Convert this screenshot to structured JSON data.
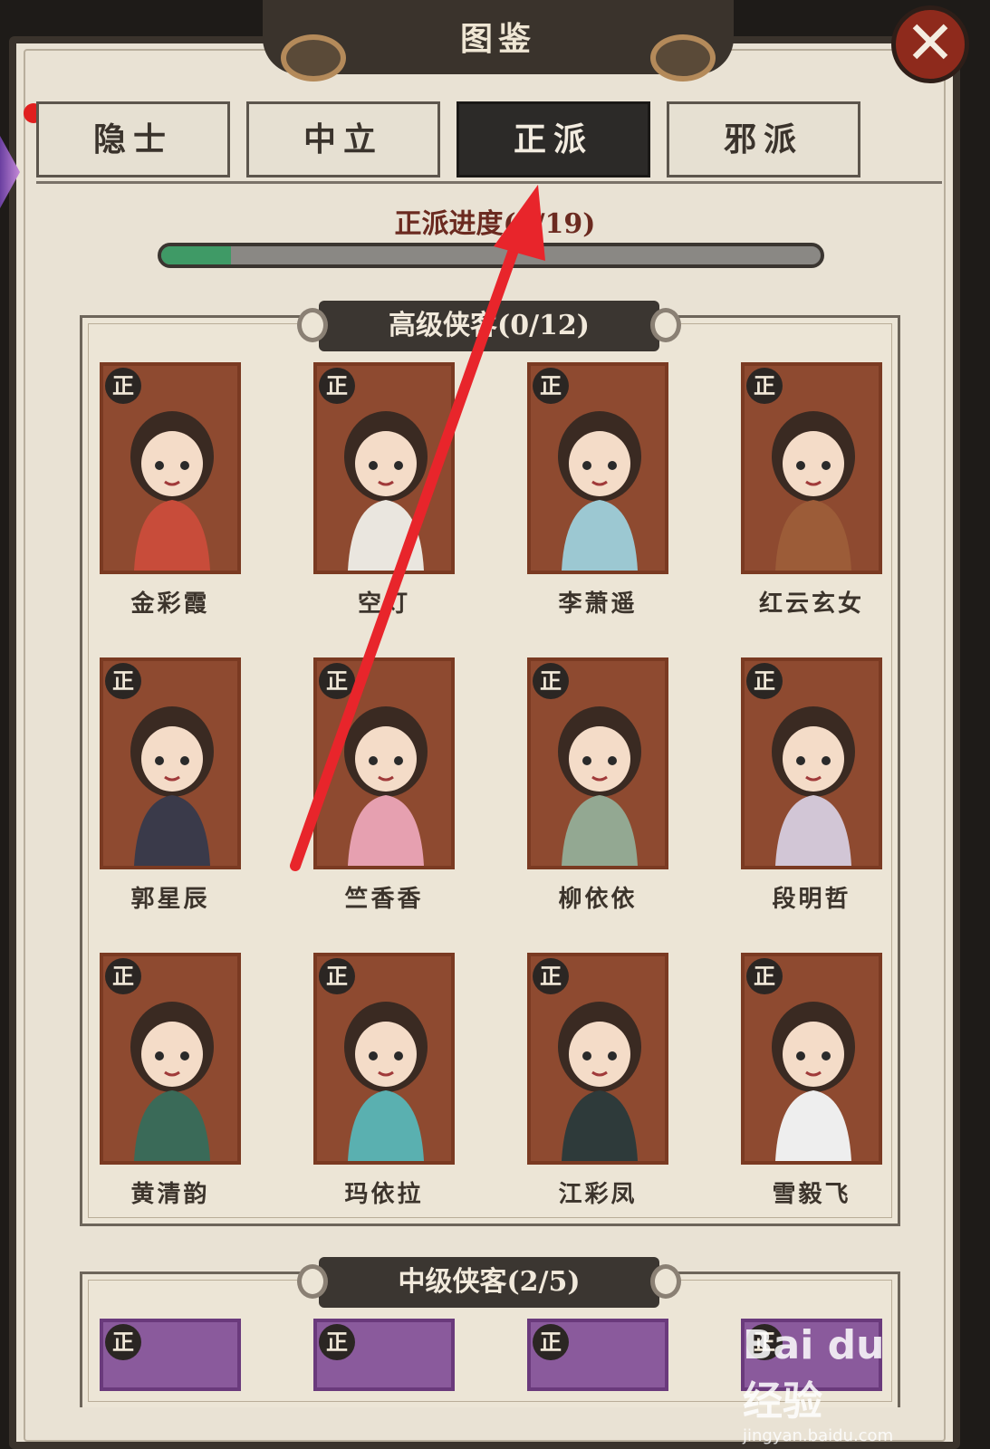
{
  "window": {
    "title": "图鉴",
    "close_glyph": "✕"
  },
  "tabs": [
    {
      "label": "隐士",
      "active": false
    },
    {
      "label": "中立",
      "active": false
    },
    {
      "label": "正派",
      "active": true
    },
    {
      "label": "邪派",
      "active": false
    }
  ],
  "progress": {
    "label": "正派进度(2/19)",
    "current": 2,
    "total": 19,
    "fill_color": "#3f9a66"
  },
  "sections": [
    {
      "title": "高级侠客(0/12)",
      "badge": "正",
      "heroes": [
        "金彩霞",
        "空灯",
        "李萧遥",
        "红云玄女",
        "郭星辰",
        "竺香香",
        "柳依依",
        "段明哲",
        "黄清韵",
        "玛依拉",
        "江彩凤",
        "雪毅飞"
      ]
    },
    {
      "title": "中级侠客(2/5)",
      "badge": "正"
    }
  ],
  "watermark": {
    "brand": "Bai du 经验",
    "url": "jingyan.baidu.com"
  },
  "annotation": {
    "type": "red-arrow",
    "color": "#e8252b"
  },
  "colors": {
    "card_high": "#8e4a30",
    "card_mid": "#8a5a9c",
    "accent_dark": "#2c2a28"
  }
}
